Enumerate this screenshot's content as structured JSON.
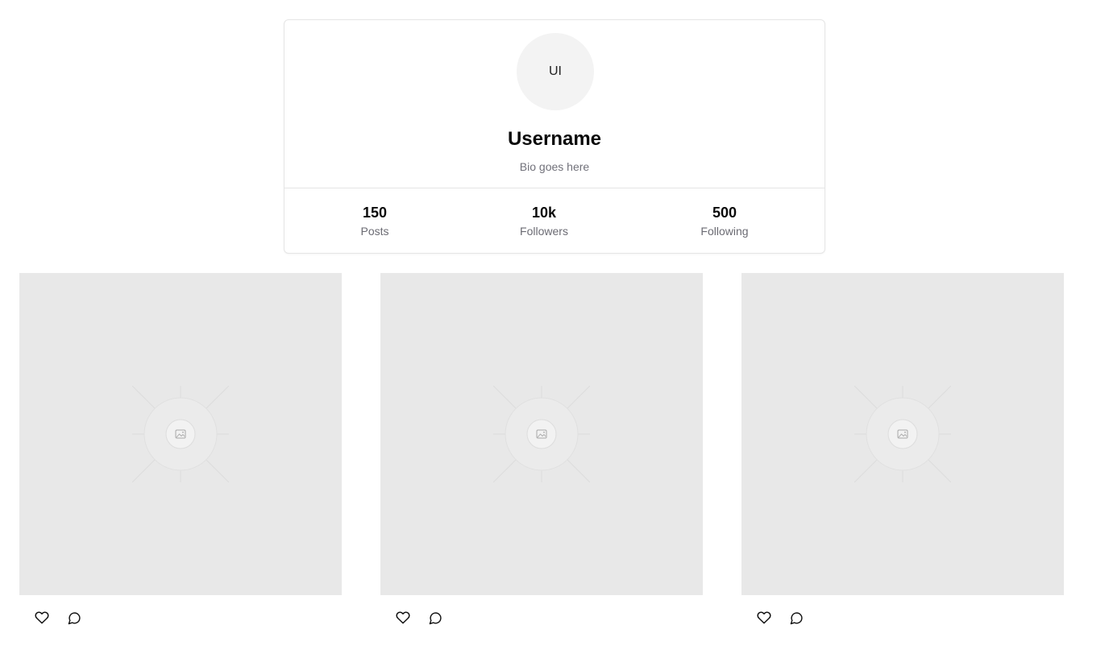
{
  "profile": {
    "avatar_initials": "UI",
    "username": "Username",
    "bio": "Bio goes here",
    "stats": [
      {
        "value": "150",
        "label": "Posts"
      },
      {
        "value": "10k",
        "label": "Followers"
      },
      {
        "value": "500",
        "label": "Following"
      }
    ]
  },
  "posts": [
    {
      "image_icon": "image-placeholder-icon",
      "actions": [
        "heart-icon",
        "comment-icon"
      ]
    },
    {
      "image_icon": "image-placeholder-icon",
      "actions": [
        "heart-icon",
        "comment-icon"
      ]
    },
    {
      "image_icon": "image-placeholder-icon",
      "actions": [
        "heart-icon",
        "comment-icon"
      ]
    }
  ],
  "colors": {
    "card_border": "#e5e5e5",
    "muted_text": "#71717a",
    "image_bg": "#e8e8e8",
    "avatar_bg": "#f3f3f3"
  }
}
